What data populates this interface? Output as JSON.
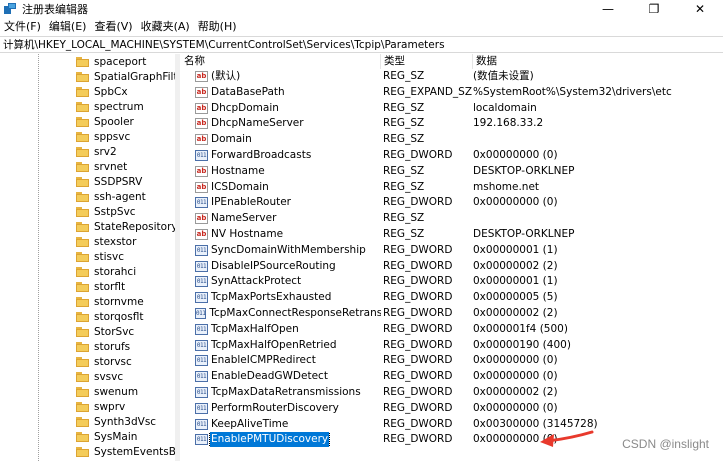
{
  "window": {
    "title": "注册表编辑器",
    "minimize_glyph": "—",
    "maximize_glyph": "❐",
    "close_glyph": "✕"
  },
  "menu": [
    "文件(F)",
    "编辑(E)",
    "查看(V)",
    "收藏夹(A)",
    "帮助(H)"
  ],
  "address": "计算机\\HKEY_LOCAL_MACHINE\\SYSTEM\\CurrentControlSet\\Services\\Tcpip\\Parameters",
  "tree": {
    "items": [
      "spaceport",
      "SpatialGraphFilter",
      "SpbCx",
      "spectrum",
      "Spooler",
      "sppsvc",
      "srv2",
      "srvnet",
      "SSDPSRV",
      "ssh-agent",
      "SstpSvc",
      "StateRepository",
      "stexstor",
      "stisvc",
      "storahci",
      "storflt",
      "stornvme",
      "storqosflt",
      "StorSvc",
      "storufs",
      "storvsc",
      "svsvc",
      "swenum",
      "swprv",
      "Synth3dVsc",
      "SysMain",
      "SystemEventsBroke"
    ]
  },
  "list": {
    "columns": {
      "name": "名称",
      "type": "类型",
      "data": "数据"
    },
    "rows": [
      {
        "icon": "string-value-icon",
        "name": "(默认)",
        "type": "REG_SZ",
        "data": "(数值未设置)"
      },
      {
        "icon": "string-value-icon",
        "name": "DataBasePath",
        "type": "REG_EXPAND_SZ",
        "data": "%SystemRoot%\\System32\\drivers\\etc"
      },
      {
        "icon": "string-value-icon",
        "name": "DhcpDomain",
        "type": "REG_SZ",
        "data": "localdomain"
      },
      {
        "icon": "string-value-icon",
        "name": "DhcpNameServer",
        "type": "REG_SZ",
        "data": "192.168.33.2"
      },
      {
        "icon": "string-value-icon",
        "name": "Domain",
        "type": "REG_SZ",
        "data": ""
      },
      {
        "icon": "binary-value-icon",
        "name": "ForwardBroadcasts",
        "type": "REG_DWORD",
        "data": "0x00000000 (0)"
      },
      {
        "icon": "string-value-icon",
        "name": "Hostname",
        "type": "REG_SZ",
        "data": "DESKTOP-ORKLNEP"
      },
      {
        "icon": "string-value-icon",
        "name": "ICSDomain",
        "type": "REG_SZ",
        "data": "mshome.net"
      },
      {
        "icon": "binary-value-icon",
        "name": "IPEnableRouter",
        "type": "REG_DWORD",
        "data": "0x00000000 (0)"
      },
      {
        "icon": "string-value-icon",
        "name": "NameServer",
        "type": "REG_SZ",
        "data": ""
      },
      {
        "icon": "string-value-icon",
        "name": "NV Hostname",
        "type": "REG_SZ",
        "data": "DESKTOP-ORKLNEP"
      },
      {
        "icon": "binary-value-icon",
        "name": "SyncDomainWithMembership",
        "type": "REG_DWORD",
        "data": "0x00000001 (1)"
      },
      {
        "icon": "binary-value-icon",
        "name": "DisableIPSourceRouting",
        "type": "REG_DWORD",
        "data": "0x00000002 (2)"
      },
      {
        "icon": "binary-value-icon",
        "name": "SynAttackProtect",
        "type": "REG_DWORD",
        "data": "0x00000001 (1)"
      },
      {
        "icon": "binary-value-icon",
        "name": "TcpMaxPortsExhausted",
        "type": "REG_DWORD",
        "data": "0x00000005 (5)"
      },
      {
        "icon": "binary-value-icon",
        "name": "TcpMaxConnectResponseRetransmi...",
        "type": "REG_DWORD",
        "data": "0x00000002 (2)"
      },
      {
        "icon": "binary-value-icon",
        "name": "TcpMaxHalfOpen",
        "type": "REG_DWORD",
        "data": "0x000001f4 (500)"
      },
      {
        "icon": "binary-value-icon",
        "name": "TcpMaxHalfOpenRetried",
        "type": "REG_DWORD",
        "data": "0x00000190 (400)"
      },
      {
        "icon": "binary-value-icon",
        "name": "EnableICMPRedirect",
        "type": "REG_DWORD",
        "data": "0x00000000 (0)"
      },
      {
        "icon": "binary-value-icon",
        "name": "EnableDeadGWDetect",
        "type": "REG_DWORD",
        "data": "0x00000000 (0)"
      },
      {
        "icon": "binary-value-icon",
        "name": "TcpMaxDataRetransmissions",
        "type": "REG_DWORD",
        "data": "0x00000002 (2)"
      },
      {
        "icon": "binary-value-icon",
        "name": "PerformRouterDiscovery",
        "type": "REG_DWORD",
        "data": "0x00000000 (0)"
      },
      {
        "icon": "binary-value-icon",
        "name": "KeepAliveTime",
        "type": "REG_DWORD",
        "data": "0x00300000 (3145728)"
      },
      {
        "icon": "binary-value-icon",
        "name": "EnablePMTUDiscovery",
        "type": "REG_DWORD",
        "data": "0x00000000 (0)",
        "selected": true
      }
    ]
  },
  "annotation": {
    "arrow_color": "#e8392c"
  },
  "watermark": "CSDN @inslight",
  "colors": {
    "selection": "#0078d7",
    "folder": "#f4cc5a",
    "string_icon_text": "#c8281f",
    "binary_icon_text": "#2a4f8c"
  }
}
